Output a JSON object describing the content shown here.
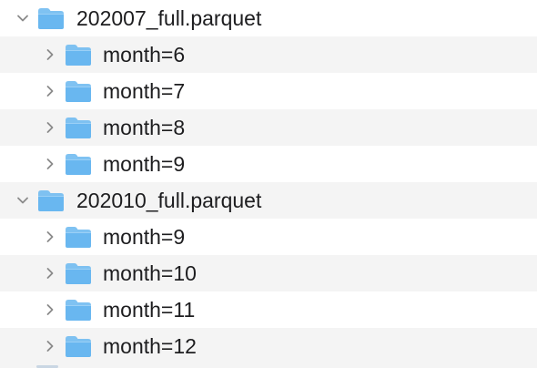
{
  "tree": {
    "folder_color": "#69b7f0",
    "items": [
      {
        "label": "202007_full.parquet",
        "level": 0,
        "expanded": true,
        "icon": "folder-icon"
      },
      {
        "label": "month=6",
        "level": 1,
        "expanded": false,
        "icon": "folder-icon"
      },
      {
        "label": "month=7",
        "level": 1,
        "expanded": false,
        "icon": "folder-icon"
      },
      {
        "label": "month=8",
        "level": 1,
        "expanded": false,
        "icon": "folder-icon"
      },
      {
        "label": "month=9",
        "level": 1,
        "expanded": false,
        "icon": "folder-icon"
      },
      {
        "label": "202010_full.parquet",
        "level": 0,
        "expanded": true,
        "icon": "folder-icon"
      },
      {
        "label": "month=9",
        "level": 1,
        "expanded": false,
        "icon": "folder-icon"
      },
      {
        "label": "month=10",
        "level": 1,
        "expanded": false,
        "icon": "folder-icon"
      },
      {
        "label": "month=11",
        "level": 1,
        "expanded": false,
        "icon": "folder-icon"
      },
      {
        "label": "month=12",
        "level": 1,
        "expanded": false,
        "icon": "folder-icon"
      }
    ]
  }
}
